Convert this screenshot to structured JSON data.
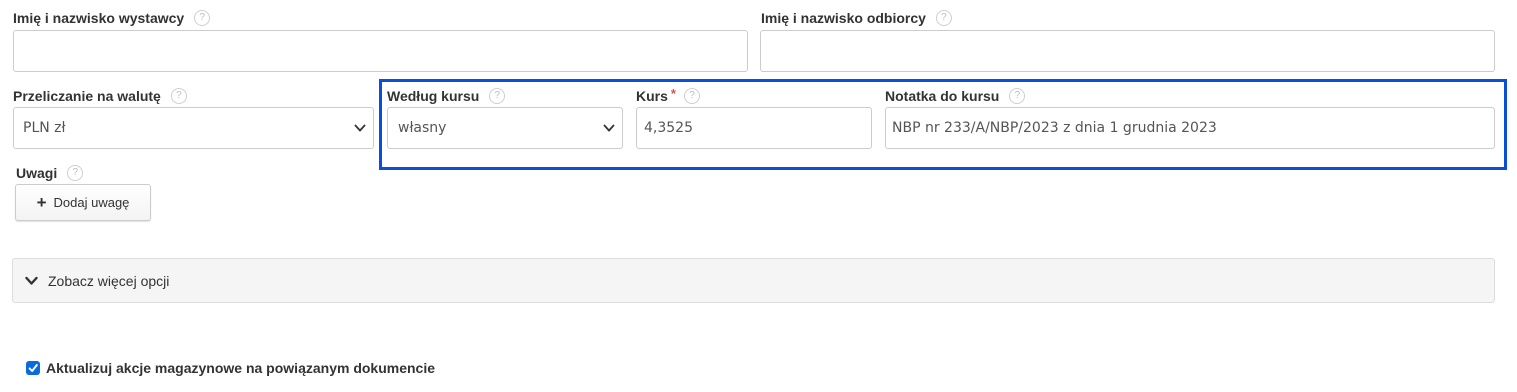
{
  "help_glyph": "?",
  "issuer": {
    "label": "Imię i nazwisko wystawcy",
    "value": ""
  },
  "recipient": {
    "label": "Imię i nazwisko odbiorcy",
    "value": ""
  },
  "currency": {
    "label": "Przeliczanie na walutę",
    "selected": "PLN zł"
  },
  "rate_source": {
    "label": "Według kursu",
    "selected": "własny"
  },
  "rate": {
    "label": "Kurs",
    "required_mark": "*",
    "value": "4,3525"
  },
  "rate_note": {
    "label": "Notatka do kursu",
    "value": "NBP nr 233/A/NBP/2023 z dnia 1 grudnia 2023"
  },
  "notes": {
    "label": "Uwagi",
    "add_button_label": "Dodaj uwagę"
  },
  "more_options": {
    "label": "Zobacz więcej opcji"
  },
  "stock_update": {
    "label": "Aktualizuj akcje magazynowe na powiązanym dokumencie",
    "checked": true
  },
  "colors": {
    "highlight_border": "#0b4fd6",
    "checkbox_fill": "#0b6bdc",
    "required_star": "#d9534f"
  }
}
